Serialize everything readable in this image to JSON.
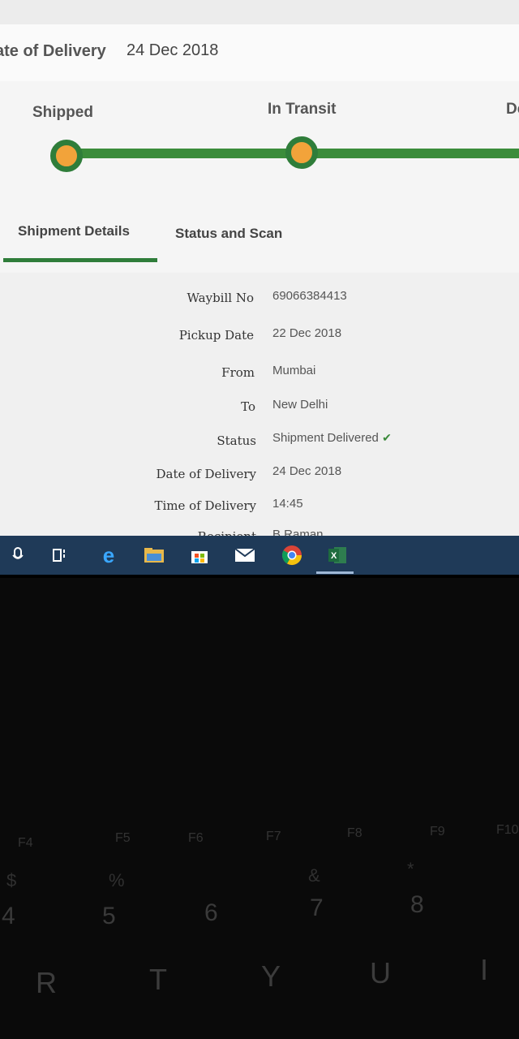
{
  "header": {
    "delivery_label": "ate of Delivery",
    "delivery_value": "24 Dec 2018"
  },
  "progress": {
    "stages": [
      "Shipped",
      "In Transit",
      "De"
    ]
  },
  "tabs": {
    "shipment_details": "Shipment Details",
    "status_and_scan": "Status and Scan"
  },
  "details": [
    {
      "label": "Waybill No",
      "value": "69066384413"
    },
    {
      "label": "Pickup Date",
      "value": "22 Dec 2018"
    },
    {
      "label": "From",
      "value": "Mumbai"
    },
    {
      "label": "To",
      "value": "New Delhi"
    },
    {
      "label": "Status",
      "value": "Shipment Delivered"
    },
    {
      "label": "Date of Delivery",
      "value": "24 Dec 2018"
    },
    {
      "label": "Time of Delivery",
      "value": "14:45"
    },
    {
      "label": "Recipient",
      "value": "B Raman"
    }
  ],
  "taskbar": {
    "icons": [
      "microphone-icon",
      "task-view-icon",
      "edge-icon",
      "file-explorer-icon",
      "store-icon",
      "mail-icon",
      "chrome-icon",
      "excel-icon"
    ]
  },
  "keyboard": {
    "fkeys": [
      "F4",
      "F5",
      "F6",
      "F7",
      "F8",
      "F9",
      "F10"
    ],
    "number_row": [
      "4",
      "5",
      "6",
      "7",
      "8"
    ],
    "symbols": [
      "$",
      "%",
      "&",
      "*"
    ],
    "letters": [
      "R",
      "T",
      "Y",
      "U",
      "I"
    ]
  },
  "colors": {
    "accent_green": "#2f7d3a",
    "node_orange": "#f2a33a",
    "taskbar": "#1f3a58"
  }
}
